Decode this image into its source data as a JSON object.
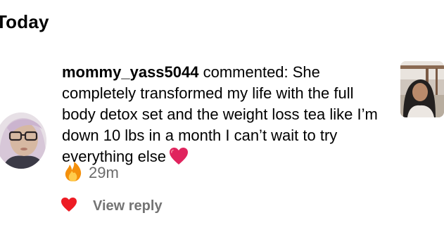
{
  "section": {
    "heading": "Today"
  },
  "notification": {
    "username": "mommy_yass5044",
    "action_text": " commented: She completely transformed my life with the full body detox set and the weight loss tea like I’m down 10 lbs in a month I can’t wait to try everything else",
    "comment_emoji_icon": "red-heart-icon",
    "reaction_icon": "fire-icon",
    "time_ago": "29m",
    "like_icon": "heart-filled-icon",
    "like_color": "#ed1c24",
    "view_reply_label": "View reply"
  }
}
